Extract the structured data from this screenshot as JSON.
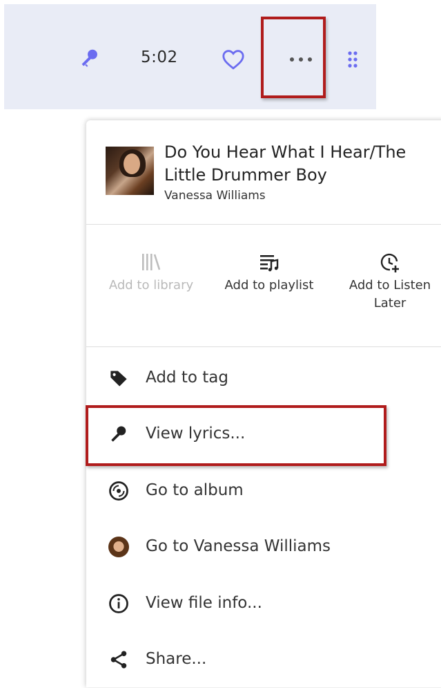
{
  "trackbar": {
    "duration": "5:02",
    "icons": [
      "microphone-icon",
      "heart-icon",
      "more-icon",
      "grip-icon"
    ],
    "accent_color": "#6b6cf0"
  },
  "menu": {
    "song_title": "Do You Hear What I Hear/The Little Drummer Boy",
    "artist": "Vanessa Williams",
    "actions": [
      {
        "label": "Add to library",
        "icon": "library-icon",
        "enabled": false
      },
      {
        "label": "Add to playlist",
        "icon": "playlist-add-icon",
        "enabled": true
      },
      {
        "label": "Add to Listen Later",
        "icon": "clock-add-icon",
        "enabled": true
      }
    ],
    "items": [
      {
        "label": "Add to tag",
        "icon": "tag-icon"
      },
      {
        "label": "View lyrics...",
        "icon": "microphone-icon"
      },
      {
        "label": "Go to album",
        "icon": "album-icon"
      },
      {
        "label": "Go to Vanessa Williams",
        "icon": "artist-avatar"
      },
      {
        "label": "View file info...",
        "icon": "info-icon"
      },
      {
        "label": "Share...",
        "icon": "share-icon"
      }
    ]
  },
  "highlight_color": "#b01c1c"
}
